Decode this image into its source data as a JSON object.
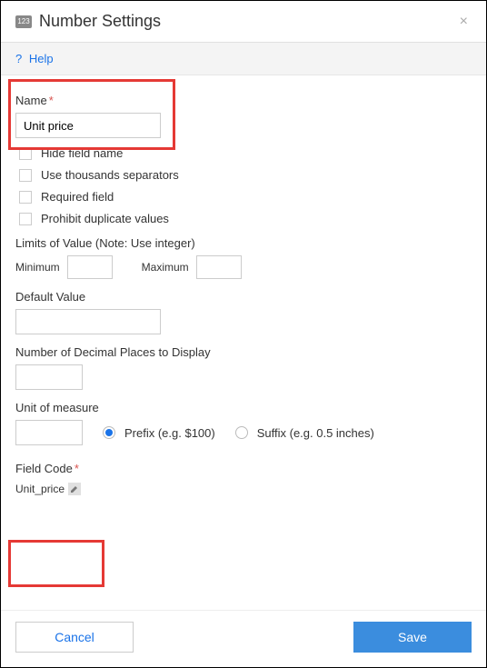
{
  "header": {
    "title": "Number Settings"
  },
  "help": {
    "label": "Help"
  },
  "form": {
    "name": {
      "label": "Name",
      "value": "Unit price"
    },
    "checkboxes": {
      "hide_field_name": "Hide field name",
      "thousands": "Use thousands separators",
      "required": "Required field",
      "prohibit_dup": "Prohibit duplicate values"
    },
    "limits": {
      "label": "Limits of Value (Note: Use integer)",
      "min_label": "Minimum",
      "max_label": "Maximum",
      "min_value": "",
      "max_value": ""
    },
    "default_value": {
      "label": "Default Value",
      "value": ""
    },
    "decimals": {
      "label": "Number of Decimal Places to Display",
      "value": ""
    },
    "unit": {
      "label": "Unit of measure",
      "value": "",
      "prefix_label": "Prefix (e.g. $100)",
      "suffix_label": "Suffix (e.g. 0.5 inches)"
    },
    "field_code": {
      "label": "Field Code",
      "value": "Unit_price"
    }
  },
  "footer": {
    "cancel": "Cancel",
    "save": "Save"
  }
}
